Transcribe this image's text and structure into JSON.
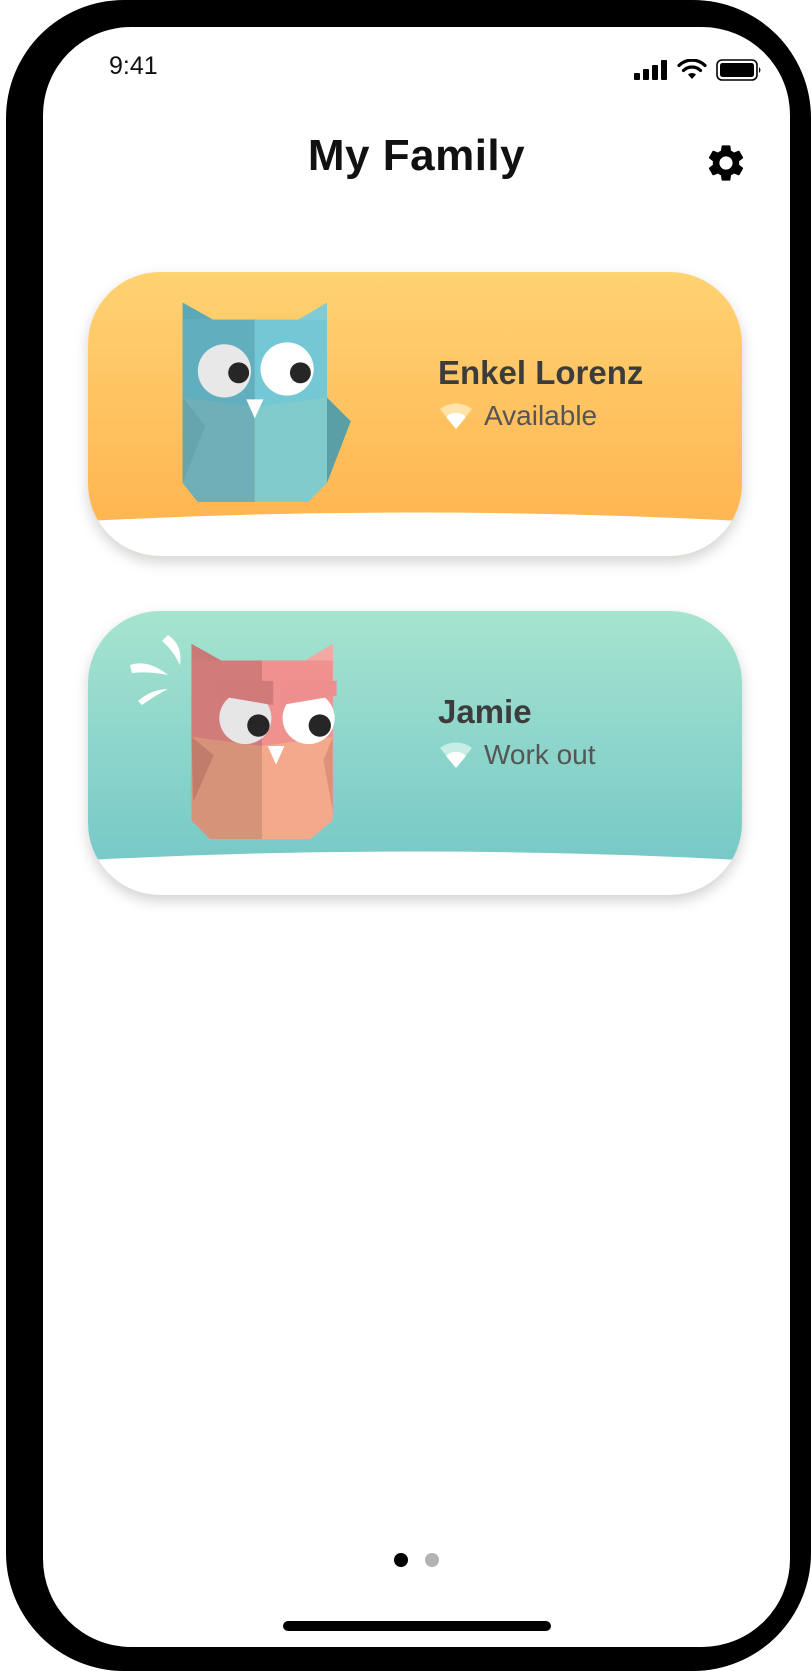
{
  "status_bar": {
    "time": "9:41"
  },
  "header": {
    "title": "My Family",
    "settings_icon": "gear-icon"
  },
  "members": [
    {
      "name": "Enkel Lorenz",
      "status": "Available",
      "status_icon": "wifi-signal-icon",
      "avatar": "teal-owl-happy",
      "card_color_top": "#FFD272",
      "card_color_bottom": "#FFB24E"
    },
    {
      "name": "Jamie",
      "status": "Work out",
      "status_icon": "wifi-signal-icon",
      "avatar": "pink-owl-angry",
      "card_color_top": "#A6E4CF",
      "card_color_bottom": "#71C5C6"
    }
  ],
  "pagination": {
    "pages": 2,
    "active_index": 0
  },
  "colors": {
    "dot_active": "#000000",
    "dot_inactive": "#B3B3B3"
  }
}
